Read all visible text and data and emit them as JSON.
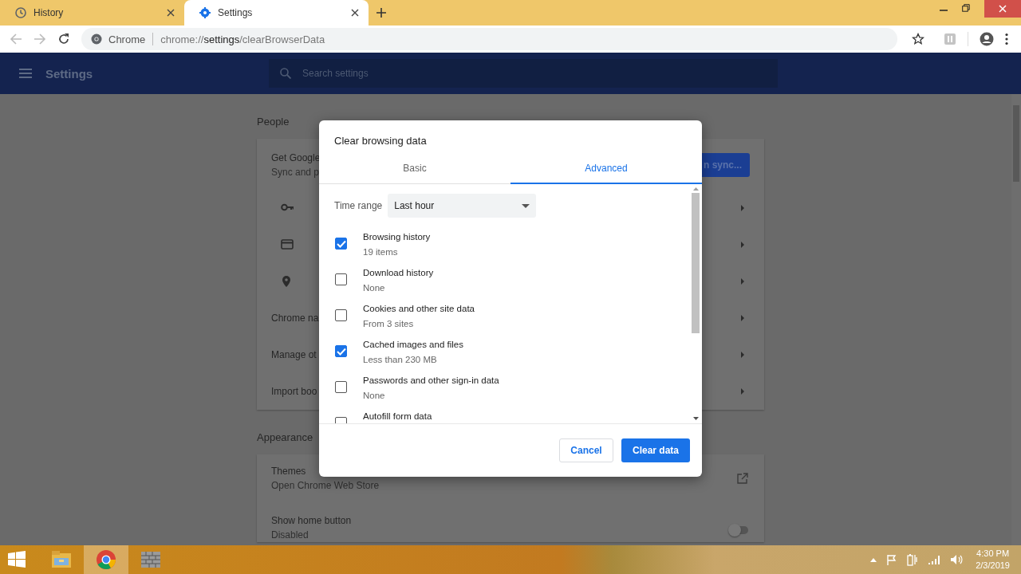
{
  "tabs": [
    {
      "label": "History",
      "kind": "history",
      "selected": false
    },
    {
      "label": "Settings",
      "kind": "settings",
      "selected": true
    }
  ],
  "toolbar": {
    "site_label": "Chrome",
    "url_prefix": "chrome://",
    "url_host": "settings",
    "url_path": "/clearBrowserData"
  },
  "settings_header": {
    "title": "Settings",
    "search_placeholder": "Search settings"
  },
  "sections": [
    {
      "heading": "People",
      "rows": [
        {
          "kind": "sync",
          "title": "Get Google",
          "subtitle": "Sync and p",
          "button": "n sync..."
        },
        {
          "kind": "key"
        },
        {
          "kind": "card"
        },
        {
          "kind": "pin"
        },
        {
          "kind": "link",
          "title": "Chrome na"
        },
        {
          "kind": "link",
          "title": "Manage ot"
        },
        {
          "kind": "link",
          "title": "Import boo"
        }
      ]
    },
    {
      "heading": "Appearance",
      "rows": [
        {
          "kind": "external",
          "title": "Themes",
          "subtitle": "Open Chrome Web Store"
        },
        {
          "kind": "toggle",
          "title": "Show home button",
          "subtitle": "Disabled",
          "on": false
        }
      ]
    }
  ],
  "dialog": {
    "title": "Clear browsing data",
    "tabs": [
      {
        "label": "Basic",
        "selected": false
      },
      {
        "label": "Advanced",
        "selected": true
      }
    ],
    "time_range": {
      "label": "Time range",
      "value": "Last hour"
    },
    "items": [
      {
        "label": "Browsing history",
        "detail": "19 items",
        "checked": true
      },
      {
        "label": "Download history",
        "detail": "None",
        "checked": false
      },
      {
        "label": "Cookies and other site data",
        "detail": "From 3 sites",
        "checked": false
      },
      {
        "label": "Cached images and files",
        "detail": "Less than 230 MB",
        "checked": true
      },
      {
        "label": "Passwords and other sign-in data",
        "detail": "None",
        "checked": false
      },
      {
        "label": "Autofill form data",
        "checked": false
      }
    ],
    "buttons": [
      {
        "label": "Cancel",
        "kind": "secondary"
      },
      {
        "label": "Clear data",
        "kind": "primary"
      }
    ]
  },
  "taskbar": {
    "apps": [
      {
        "kind": "explorer",
        "selected": false
      },
      {
        "kind": "browser",
        "selected": true
      },
      {
        "kind": "app",
        "selected": false
      }
    ],
    "time": "4:30 PM",
    "date": "2/3/2019"
  }
}
